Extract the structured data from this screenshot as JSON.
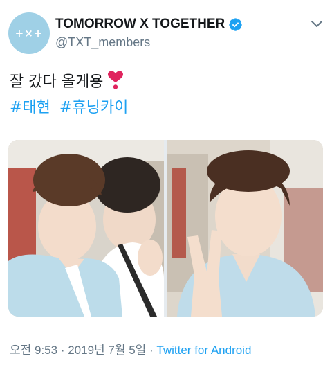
{
  "profile": {
    "avatar_text": "+×+",
    "display_name": "TOMORROW X TOGETHER",
    "handle": "@TXT_members"
  },
  "tweet": {
    "text": "잘 갔다 올게용",
    "hashtags": [
      "#태현",
      "#휴닝카이"
    ]
  },
  "footer": {
    "time": "오전 9:53",
    "separator1": " · ",
    "date": "2019년 7월 5일",
    "separator2": " · ",
    "client": "Twitter for Android"
  },
  "colors": {
    "accent": "#1da1f2",
    "verified": "#1da1f2",
    "heart": "#e0245e",
    "muted_text": "#657786",
    "avatar_bg": "#9fd0e6"
  },
  "icons": {
    "verified": "verified-badge-icon",
    "more": "chevron-down-icon",
    "emoji": "heavy-heart-exclamation-icon"
  }
}
